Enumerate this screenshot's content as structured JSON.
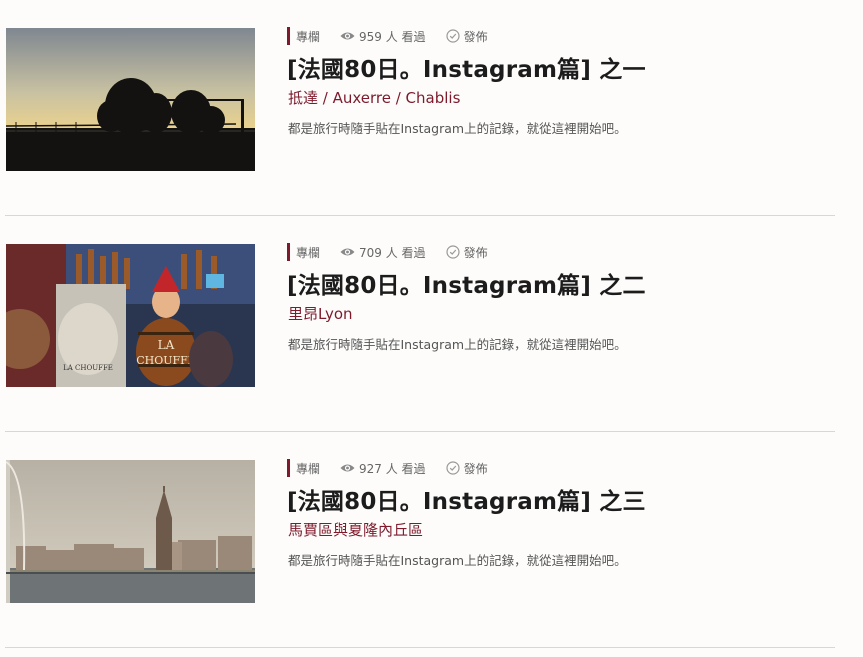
{
  "accent_color": "#7d1a2b",
  "posts": [
    {
      "category": "專欄",
      "views": "959 人 看過",
      "status": "發佈",
      "title": "[法國80日。Instagram篇] 之一",
      "subtitle": "抵達 / Auxerre / Chablis",
      "excerpt": "都是旅行時隨手貼在Instagram上的記錄，就從這裡開始吧。"
    },
    {
      "category": "專欄",
      "views": "709 人 看過",
      "status": "發佈",
      "title": "[法國80日。Instagram篇] 之二",
      "subtitle": "里昂Lyon",
      "excerpt": "都是旅行時隨手貼在Instagram上的記錄，就從這裡開始吧。"
    },
    {
      "category": "專欄",
      "views": "927 人 看過",
      "status": "發佈",
      "title": "[法國80日。Instagram篇] 之三",
      "subtitle": "馬賈區與夏隆內丘區",
      "excerpt": "都是旅行時隨手貼在Instagram上的記錄，就從這裡開始吧。"
    }
  ]
}
